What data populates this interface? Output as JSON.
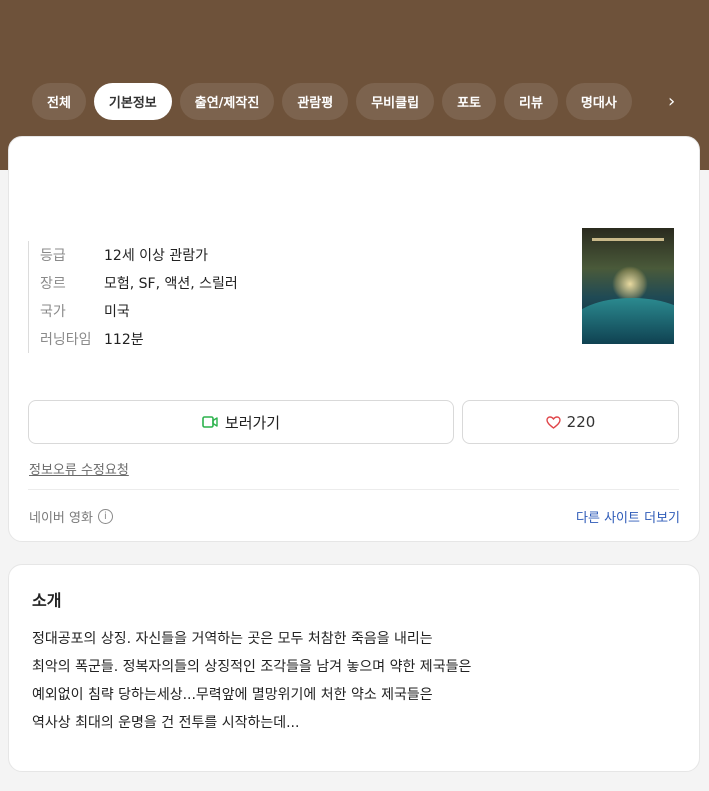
{
  "tabs": [
    {
      "label": "전체"
    },
    {
      "label": "기본정보"
    },
    {
      "label": "출연/제작진"
    },
    {
      "label": "관람평"
    },
    {
      "label": "무비클립"
    },
    {
      "label": "포토"
    },
    {
      "label": "리뷰"
    },
    {
      "label": "명대사"
    }
  ],
  "tabs_more_icon": "chevron-right-icon",
  "info": {
    "rows": [
      {
        "key": "등급",
        "value": "12세 이상 관람가"
      },
      {
        "key": "장르",
        "value": "모험, SF, 액션, 스릴러"
      },
      {
        "key": "국가",
        "value": "미국"
      },
      {
        "key": "러닝타임",
        "value": "112분"
      }
    ]
  },
  "actions": {
    "watch_label": "보러가기",
    "watch_icon": "play-screen-icon",
    "like_count": "220",
    "like_icon": "heart-icon"
  },
  "error_report_label": "정보오류 수정요청",
  "source": {
    "label": "네이버 영화",
    "more_sites_label": "다른 사이트 더보기"
  },
  "intro": {
    "title": "소개",
    "lines": [
      "정대공포의 상징. 자신들을 거역하는 곳은 모두 처참한 죽음을 내리는",
      "최악의 폭군들. 정복자의들의 상징적인 조각들을 남겨 놓으며 약한 제국들은",
      "예외없이 침략 당하는세상...무력앞에 멸망위기에 처한 약소 제국들은",
      "역사상 최대의 운명을 건 전투를 시작하는데..."
    ]
  },
  "colors": {
    "hero_bg": "#6e523a",
    "link_blue": "#2e5bb8",
    "watch_icon_green": "#2bb24c",
    "heart_red": "#e0464a"
  }
}
